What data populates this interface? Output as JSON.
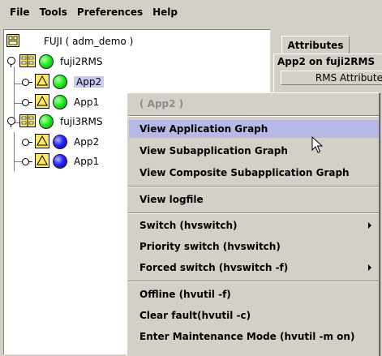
{
  "menubar": {
    "items": [
      "File",
      "Tools",
      "Preferences",
      "Help"
    ]
  },
  "tree": {
    "root_label": "FUJI ( adm_demo )",
    "nodes": [
      {
        "label": "fuji2RMS"
      },
      {
        "label": "App2"
      },
      {
        "label": "App1"
      },
      {
        "label": "fuji3RMS"
      },
      {
        "label": "App2"
      },
      {
        "label": "App1"
      }
    ]
  },
  "right_panel": {
    "tab_label": "Attributes",
    "title": "App2 on fuji2RMS",
    "column_header": "RMS Attribute"
  },
  "context_menu": {
    "header": "( App2 )",
    "items": [
      {
        "label": "View Application Graph"
      },
      {
        "label": "View Subapplication Graph"
      },
      {
        "label": "View Composite Subapplication Graph"
      },
      {
        "label": "View logfile"
      },
      {
        "label": "Switch (hvswitch)"
      },
      {
        "label": "Priority switch (hvswitch)"
      },
      {
        "label": "Forced switch (hvswitch -f)"
      },
      {
        "label": "Offline (hvutil -f)"
      },
      {
        "label": "Clear fault(hvutil -c)"
      },
      {
        "label": "Enter Maintenance Mode (hvutil -m on)"
      }
    ]
  },
  "colors": {
    "background": "#d4d0c8",
    "selection": "#c9c9f2",
    "menu_highlight": "#b8b8e6",
    "online_status": "#22ee22",
    "offline_status": "#2222ff"
  }
}
